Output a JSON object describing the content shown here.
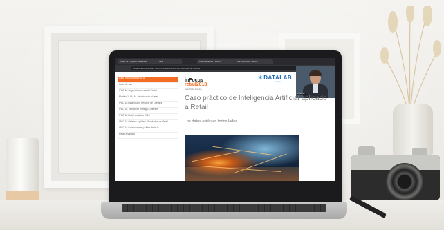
{
  "browser": {
    "tabs": [
      "Caso de Proyecto RetailDIIR",
      "Infai",
      "Live Interactive - Zoom",
      "Live Interactive - Zoom"
    ],
    "url": "collaborate.blackboard.com/ultra/sessions/infocus-retail/caso-de-ia-retail"
  },
  "sidebar": {
    "items": [
      "Caso Infocus Retail 2018",
      "Caso de uso",
      "IPAD 18 Sugerir trasversal del Retail",
      "Modulo 1: IRAA - Introducción al retail",
      "IPAD 18 Diagnóstico Pedidos de Clientes",
      "IPAD 18 Tiempo de entrega a clientes",
      "IPAD 18 Retail analytics 2018",
      "IPAD 18 Sistema Agilidad - Productos de Retail",
      "IPAD 18 Conclusiones y Mitos de la IA",
      "Retail Analytics"
    ]
  },
  "logo": {
    "line1": "inFocus",
    "line2": "retail",
    "year": "2018",
    "sub": "Retail Digital Analytics"
  },
  "brand": {
    "name": "DATALAB",
    "sub": "Analytics"
  },
  "webcam": {
    "name": "Presenter"
  },
  "slide": {
    "title": "Caso práctico de Inteligencia Artificial aplicado a Retail",
    "subtitle": "Los datos están en todos lados"
  },
  "colors": {
    "accent": "#f36c21",
    "brand": "#1c66b0"
  }
}
